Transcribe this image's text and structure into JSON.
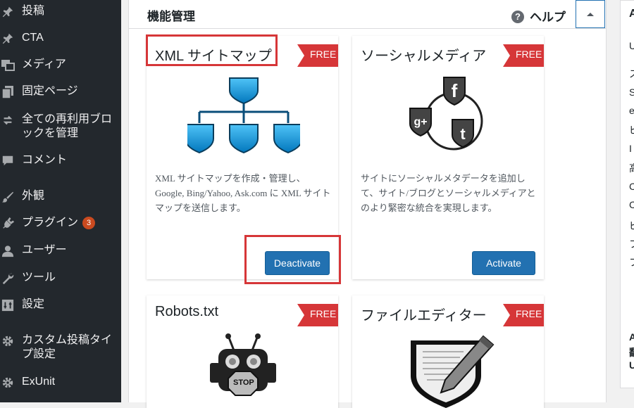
{
  "sidebar": {
    "items": [
      {
        "label": "投稿",
        "icon": "pin-icon"
      },
      {
        "label": "CTA",
        "icon": "pin-icon"
      },
      {
        "label": "メディア",
        "icon": "media-icon"
      },
      {
        "label": "固定ページ",
        "icon": "pages-icon"
      },
      {
        "label": "全ての再利用ブロックを管理",
        "icon": "reuse-icon"
      },
      {
        "label": "コメント",
        "icon": "comment-icon"
      },
      {
        "label": "外観",
        "icon": "brush-icon"
      },
      {
        "label": "プラグイン",
        "icon": "plugin-icon",
        "badge": "3"
      },
      {
        "label": "ユーザー",
        "icon": "user-icon"
      },
      {
        "label": "ツール",
        "icon": "wrench-icon"
      },
      {
        "label": "設定",
        "icon": "settings-icon"
      },
      {
        "label": "カスタム投稿タイプ設定",
        "icon": "gear-icon"
      },
      {
        "label": "ExUnit",
        "icon": "gear-icon"
      }
    ]
  },
  "panel": {
    "title": "機能管理",
    "help_label": "ヘルプ",
    "help_icon": "?"
  },
  "cards": [
    {
      "title": "XML サイトマップ",
      "ribbon": "FREE",
      "description": "XML サイトマップを作成・管理し、Google, Bing/Yahoo, Ask.com に XML サイトマップを送信します。",
      "button": "Deactivate"
    },
    {
      "title": "ソーシャルメディア",
      "ribbon": "FREE",
      "description": "サイトにソーシャルメタデータを追加して、サイト/ブログとソーシャルメディアとのより緊密な統合を実現します。",
      "button": "Activate"
    },
    {
      "title": "Robots.txt",
      "ribbon": "FREE",
      "stop_label": "STOP"
    },
    {
      "title": "ファイルエディター",
      "ribbon": "FREE"
    }
  ],
  "side_panel": {
    "title": "A",
    "lines": [
      "U",
      "ス",
      "S",
      "e",
      "ビ",
      "I",
      "高",
      "C",
      "C",
      "ビ",
      "フ",
      "フ"
    ],
    "bottom_lines": [
      "A",
      "翻",
      "U"
    ]
  },
  "colors": {
    "sidebar_bg": "#23282d",
    "button_blue": "#2271b1",
    "ribbon_red": "#d63638",
    "highlight_red": "#d63638"
  }
}
